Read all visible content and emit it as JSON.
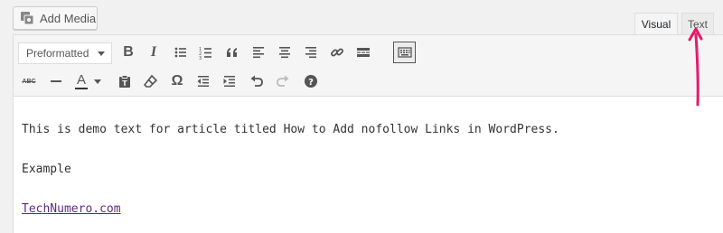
{
  "media": {
    "add_label": "Add Media"
  },
  "tabs": {
    "visual": "Visual",
    "text": "Text"
  },
  "toolbar": {
    "format_select": "Preformatted",
    "row1_icons": [
      "bold-icon",
      "italic-icon",
      "bullet-list-icon",
      "numbered-list-icon",
      "blockquote-icon",
      "align-left-icon",
      "align-center-icon",
      "align-right-icon",
      "link-icon",
      "read-more-icon",
      "toolbar-toggle-icon"
    ],
    "row2_icons": [
      "strikethrough-icon",
      "horizontal-line-icon",
      "text-color-icon",
      "paste-as-text-icon",
      "clear-formatting-icon",
      "special-character-icon",
      "outdent-icon",
      "indent-icon",
      "undo-icon",
      "redo-icon",
      "help-icon"
    ],
    "bold": "B",
    "italic": "I",
    "omega": "Ω",
    "text_color_letter": "A",
    "strike_label": "ABC"
  },
  "content": {
    "line1": "This is demo text for article titled How to Add nofollow Links in WordPress.",
    "line2": "Example",
    "link_text": "TechNumero.com"
  },
  "colors": {
    "accent_arrow": "#e8196a",
    "link": "#5b2b83"
  }
}
